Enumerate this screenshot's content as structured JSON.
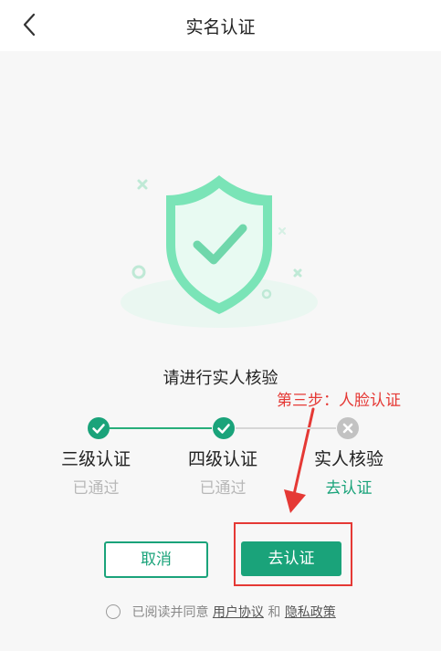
{
  "nav": {
    "title": "实名认证",
    "back_icon": "chevron-left-icon"
  },
  "main": {
    "prompt": "请进行实人核验",
    "annotation": "第三步：人脸认证"
  },
  "steps": [
    {
      "label": "三级认证",
      "status": "已通过",
      "state": "done"
    },
    {
      "label": "四级认证",
      "status": "已通过",
      "state": "done"
    },
    {
      "label": "实人核验",
      "status": "去认证",
      "state": "todo"
    }
  ],
  "buttons": {
    "cancel_label": "取消",
    "go_label": "去认证"
  },
  "agreement": {
    "prefix": "已阅读并同意",
    "user_agreement": "用户协议",
    "and": "和",
    "privacy_policy": "隐私政策"
  },
  "colors": {
    "accent": "#1aa37a",
    "shield": "#7ae4b7",
    "annotation": "#e53935",
    "muted": "#b8b8b8"
  }
}
